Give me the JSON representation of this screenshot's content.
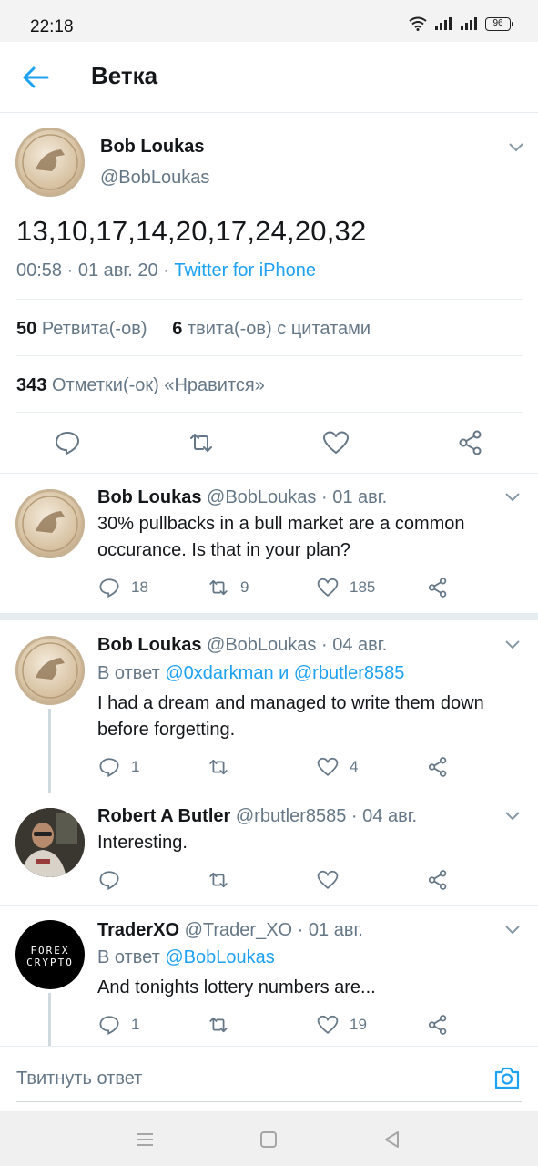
{
  "status_bar": {
    "time": "22:18",
    "battery": "96"
  },
  "header": {
    "title": "Ветка"
  },
  "main_tweet": {
    "name": "Bob Loukas",
    "handle": "@BobLoukas",
    "text": "13,10,17,14,20,17,24,20,32",
    "time": "00:58",
    "date": "01 авг. 20",
    "source": "Twitter for iPhone",
    "retweets_count": "50",
    "retweets_label": "Ретвита(-ов)",
    "quotes_count": "6",
    "quotes_label": "твита(-ов) с цитатами",
    "likes_count": "343",
    "likes_label": "Отметки(-ок) «Нравится»"
  },
  "replies": [
    {
      "name": "Bob Loukas",
      "handle": "@BobLoukas",
      "date": "01 авг.",
      "text": "30% pullbacks in a bull market are a common occurance. Is that in your plan?",
      "replies": "18",
      "retweets": "9",
      "likes": "185"
    },
    {
      "name": "Bob Loukas",
      "handle": "@BobLoukas",
      "date": "04 авг.",
      "reply_prefix": "В ответ",
      "reply_to_1": "@0xdarkman",
      "reply_joiner": "и",
      "reply_to_2": "@rbutler8585",
      "text": "I had a dream and managed to write them down before forgetting.",
      "replies": "1",
      "retweets": "",
      "likes": "4"
    },
    {
      "name": "Robert A Butler",
      "handle": "@rbutler8585",
      "date": "04 авг.",
      "text": "Interesting.",
      "replies": "",
      "retweets": "",
      "likes": ""
    },
    {
      "name": "TraderXO",
      "handle": "@Trader_XO",
      "date": "01 авг.",
      "reply_prefix": "В ответ",
      "reply_to_1": "@BobLoukas",
      "text": "And tonights lottery numbers are...",
      "avatar_line1": "FOREX",
      "avatar_line2": "CRYPTO",
      "replies": "1",
      "retweets": "",
      "likes": "19"
    }
  ],
  "compose": {
    "placeholder": "Твитнуть ответ"
  },
  "colors": {
    "accent": "#1da1f2",
    "text": "#14171a",
    "secondary": "#657786",
    "border": "#e6ecf0"
  }
}
